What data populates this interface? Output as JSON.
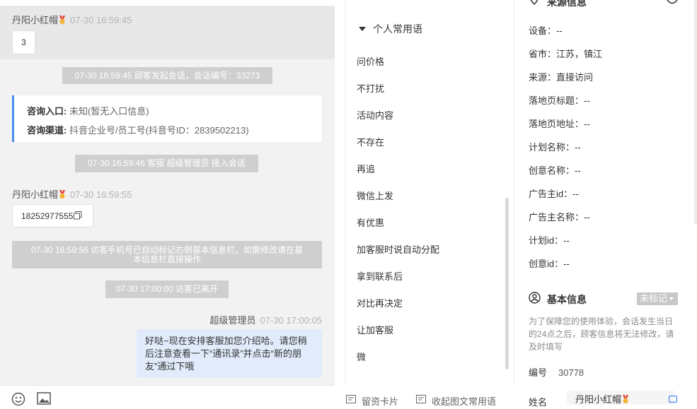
{
  "chat": {
    "messages": [
      {
        "sender": "丹阳小红帽",
        "time": "07-30 16:59:45",
        "text": "3"
      },
      {
        "system": "07-30 16:59:45 顾客发起会话，会话编号：33273"
      },
      {
        "card": {
          "entry_label": "咨询入口:",
          "entry_value": "未知(暂无入口信息)",
          "channel_label": "咨询渠道:",
          "channel_value": "抖音企业号/员工号(抖音号ID：2839502213)"
        }
      },
      {
        "system": "07-30 16:59:46 客服 超级管理员 接入会话"
      },
      {
        "sender": "丹阳小红帽",
        "time": "07-30 16:59:55",
        "text": "18252977555"
      },
      {
        "system_line1": "07-30 16:59:56 访客手机号已自动标记右侧基本信息栏，如需修改请在基",
        "system_line2": "本信息栏直接操作"
      },
      {
        "system": "07-30 17:00:00 访客已离开"
      },
      {
        "agent": "超级管理员",
        "time": "07-30 17:00:05",
        "line1": "好哒~现在安排客服加您介绍哈。请您稍",
        "line2": "后注意查看一下“通讯录”并点击“新的朋",
        "line3": "友”通过下哦"
      }
    ]
  },
  "phrases": {
    "header": "个人常用语",
    "items": [
      "问价格",
      "不打扰",
      "活动内容",
      "不存在",
      "再追",
      "微信上发",
      "有优惠",
      "加客服时说自动分配",
      "拿到联系后",
      "对比再决定",
      "让加客服",
      "微"
    ],
    "footer_card": "留资卡片",
    "footer_common": "收起图文常用语"
  },
  "source": {
    "title": "来源信息",
    "rows": [
      {
        "label": "设备：",
        "value": "--"
      },
      {
        "label": "省市：",
        "value": "江苏，镇江"
      },
      {
        "label": "来源：",
        "value": "直接访问"
      },
      {
        "label": "落地页标题：",
        "value": "--"
      },
      {
        "label": "落地页地址：",
        "value": "--"
      },
      {
        "label": "计划名称：",
        "value": "--"
      },
      {
        "label": "创意名称：",
        "value": "--"
      },
      {
        "label": "广告主id：",
        "value": "--"
      },
      {
        "label": "广告主名称：",
        "value": "--"
      },
      {
        "label": "计划id：",
        "value": "--"
      },
      {
        "label": "创意id：",
        "value": "--"
      }
    ]
  },
  "basic": {
    "title": "基本信息",
    "tag": "未标记",
    "notice_line1": "为了保障您的使用体验，会话发生当日",
    "notice_line2": "的24点之后，顾客信息将无法修改，请",
    "notice_line3": "及时填写",
    "id_label": "编号",
    "id_value": "30778",
    "name_label": "姓名",
    "name_value": "丹阳小红帽"
  }
}
